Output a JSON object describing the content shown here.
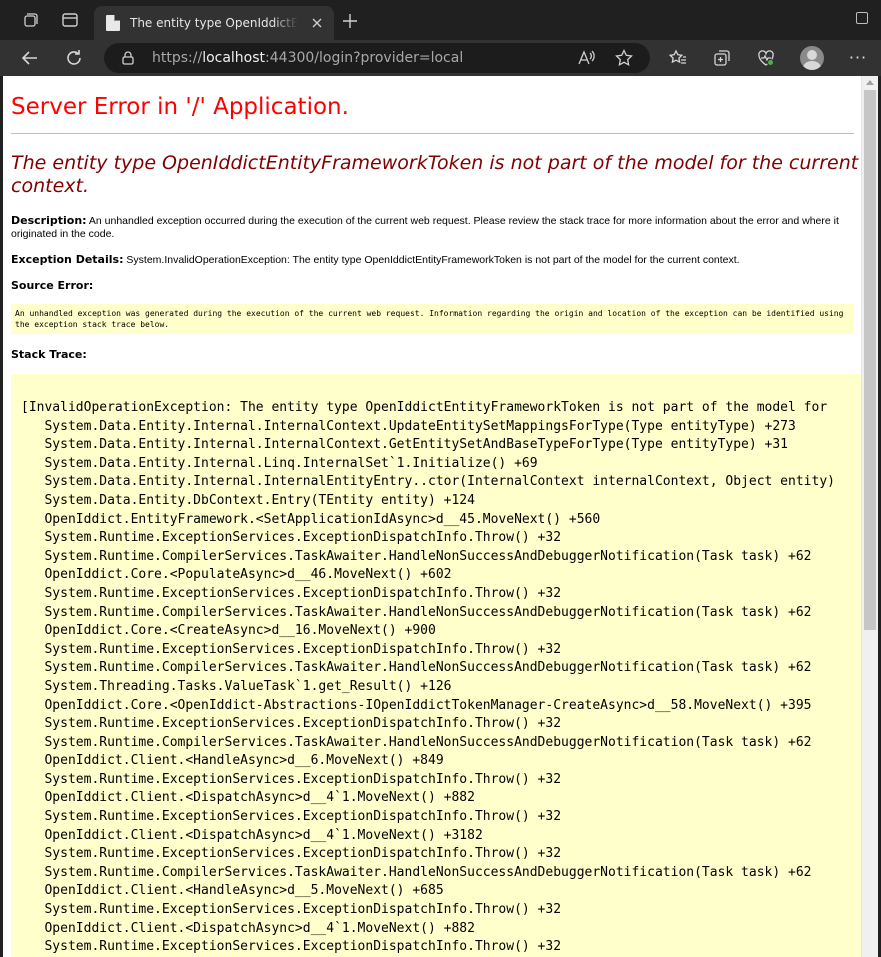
{
  "browser": {
    "tab_title": "The entity type OpenIddictEntityFrameworkToken is not part of the model for the current context.",
    "url_prefix": "https://",
    "url_host": "localhost",
    "url_rest": ":44300/login?provider=local",
    "new_tab_label": "+",
    "more_label": "···"
  },
  "page": {
    "title": "Server Error in '/' Application.",
    "error_heading": "The entity type OpenIddictEntityFrameworkToken is not part of the model for the current context.",
    "description_label": "Description:",
    "description_text": " An unhandled exception occurred during the execution of the current web request. Please review the stack trace for more information about the error and where it originated in the code.",
    "exception_label": "Exception Details:",
    "exception_text": " System.InvalidOperationException: The entity type OpenIddictEntityFrameworkToken is not part of the model for the current context.",
    "source_error_label": "Source Error:",
    "source_error_text": "An unhandled exception was generated during the execution of the current web request. Information regarding the origin and location of the exception can be identified using the exception stack trace below.",
    "stack_trace_label": "Stack Trace:",
    "stack_trace_lines": [
      "[InvalidOperationException: The entity type OpenIddictEntityFrameworkToken is not part of the model for",
      "   System.Data.Entity.Internal.InternalContext.UpdateEntitySetMappingsForType(Type entityType) +273",
      "   System.Data.Entity.Internal.InternalContext.GetEntitySetAndBaseTypeForType(Type entityType) +31",
      "   System.Data.Entity.Internal.Linq.InternalSet`1.Initialize() +69",
      "   System.Data.Entity.Internal.InternalEntityEntry..ctor(InternalContext internalContext, Object entity)",
      "   System.Data.Entity.DbContext.Entry(TEntity entity) +124",
      "   OpenIddict.EntityFramework.<SetApplicationIdAsync>d__45.MoveNext() +560",
      "   System.Runtime.ExceptionServices.ExceptionDispatchInfo.Throw() +32",
      "   System.Runtime.CompilerServices.TaskAwaiter.HandleNonSuccessAndDebuggerNotification(Task task) +62",
      "   OpenIddict.Core.<PopulateAsync>d__46.MoveNext() +602",
      "   System.Runtime.ExceptionServices.ExceptionDispatchInfo.Throw() +32",
      "   System.Runtime.CompilerServices.TaskAwaiter.HandleNonSuccessAndDebuggerNotification(Task task) +62",
      "   OpenIddict.Core.<CreateAsync>d__16.MoveNext() +900",
      "   System.Runtime.ExceptionServices.ExceptionDispatchInfo.Throw() +32",
      "   System.Runtime.CompilerServices.TaskAwaiter.HandleNonSuccessAndDebuggerNotification(Task task) +62",
      "   System.Threading.Tasks.ValueTask`1.get_Result() +126",
      "   OpenIddict.Core.<OpenIddict-Abstractions-IOpenIddictTokenManager-CreateAsync>d__58.MoveNext() +395",
      "   System.Runtime.ExceptionServices.ExceptionDispatchInfo.Throw() +32",
      "   System.Runtime.CompilerServices.TaskAwaiter.HandleNonSuccessAndDebuggerNotification(Task task) +62",
      "   OpenIddict.Client.<HandleAsync>d__6.MoveNext() +849",
      "   System.Runtime.ExceptionServices.ExceptionDispatchInfo.Throw() +32",
      "   OpenIddict.Client.<DispatchAsync>d__4`1.MoveNext() +882",
      "   System.Runtime.ExceptionServices.ExceptionDispatchInfo.Throw() +32",
      "   OpenIddict.Client.<DispatchAsync>d__4`1.MoveNext() +3182",
      "   System.Runtime.ExceptionServices.ExceptionDispatchInfo.Throw() +32",
      "   System.Runtime.CompilerServices.TaskAwaiter.HandleNonSuccessAndDebuggerNotification(Task task) +62",
      "   OpenIddict.Client.<HandleAsync>d__5.MoveNext() +685",
      "   System.Runtime.ExceptionServices.ExceptionDispatchInfo.Throw() +32",
      "   OpenIddict.Client.<DispatchAsync>d__4`1.MoveNext() +882",
      "   System.Runtime.ExceptionServices.ExceptionDispatchInfo.Throw() +32"
    ]
  },
  "colors": {
    "title_red": "#ff0000",
    "heading_maroon": "#800000",
    "box_yellow": "#ffffcc"
  }
}
